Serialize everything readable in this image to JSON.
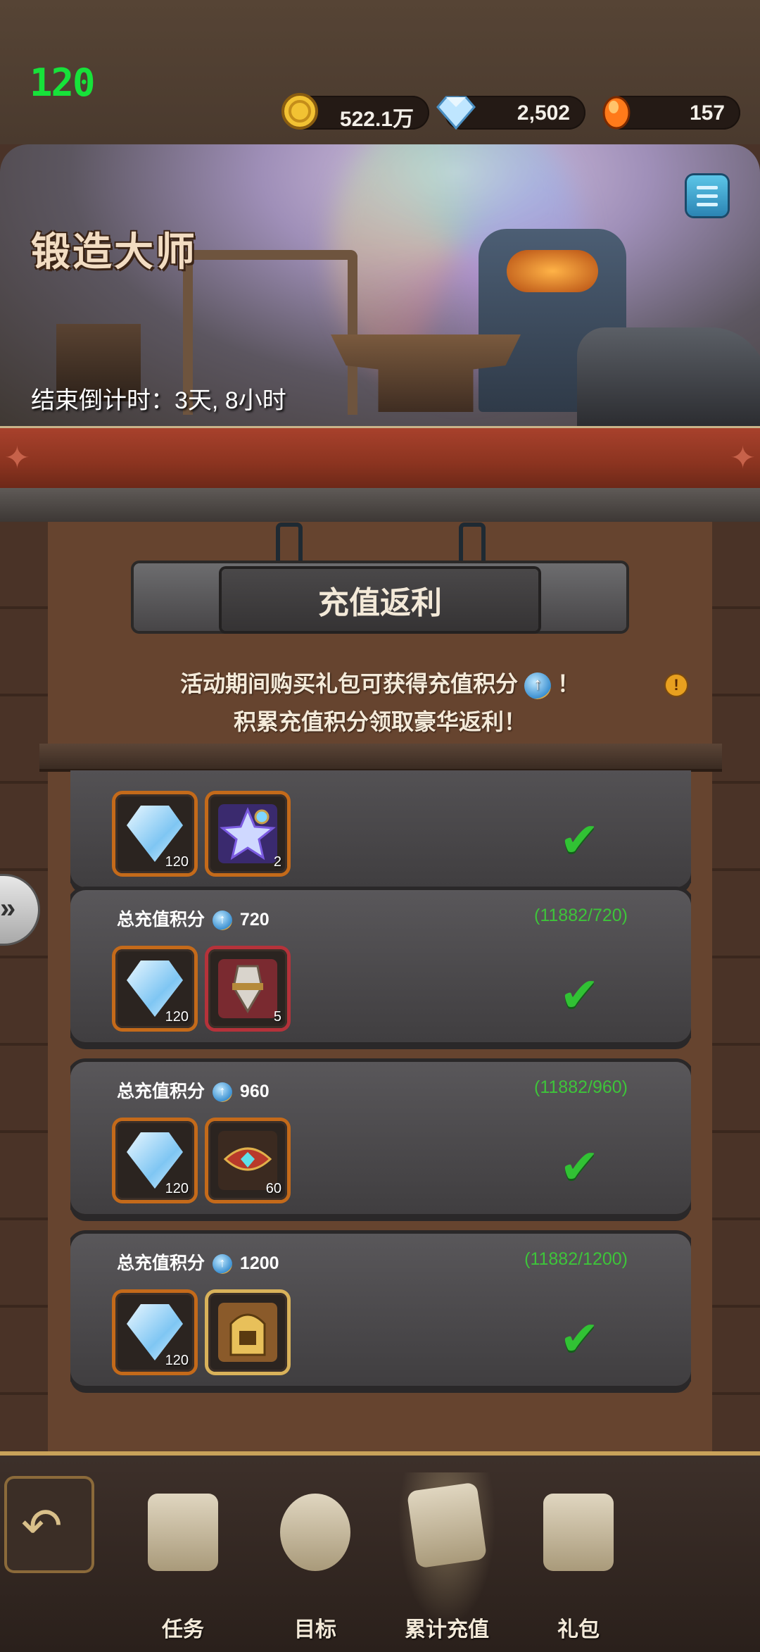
{
  "status": {
    "fps": "120",
    "resources": [
      {
        "name": "gold",
        "value": "522.1万",
        "icon": "gold-coin-icon",
        "color": "#f2c233"
      },
      {
        "name": "diamond",
        "value": "2,502",
        "icon": "diamond-icon",
        "color": "#9fd8ff"
      },
      {
        "name": "ember",
        "value": "157",
        "icon": "fire-gem-icon",
        "color": "#ff7a1a"
      }
    ]
  },
  "banner": {
    "title": "锻造大师",
    "countdown": "结束倒计时：3天, 8小时"
  },
  "section": {
    "title": "充值返利",
    "desc_line1": "活动期间购买礼包可获得充值积分",
    "desc_line1_end": "！",
    "desc_line2": "积累充值积分领取豪华返利！",
    "info_icon": "!"
  },
  "rewards": [
    {
      "label": "",
      "points": "",
      "progress": "",
      "items": [
        {
          "icon": "diamond-icon",
          "count": "120"
        },
        {
          "icon": "star-potion-icon",
          "count": "2"
        }
      ],
      "claimed": true
    },
    {
      "label": "总充值积分",
      "points": "720",
      "progress": "(11882/720)",
      "items": [
        {
          "icon": "diamond-icon",
          "count": "120"
        },
        {
          "icon": "crystal-shard-icon",
          "count": "5"
        }
      ],
      "claimed": true
    },
    {
      "label": "总充值积分",
      "points": "960",
      "progress": "(11882/960)",
      "items": [
        {
          "icon": "diamond-icon",
          "count": "120"
        },
        {
          "icon": "scroll-gem-icon",
          "count": "60"
        }
      ],
      "claimed": true
    },
    {
      "label": "总充值积分",
      "points": "1200",
      "progress": "(11882/1200)",
      "items": [
        {
          "icon": "diamond-icon",
          "count": "120"
        },
        {
          "icon": "golden-helmet-icon",
          "count": ""
        }
      ],
      "claimed": true
    }
  ],
  "nav": {
    "items": [
      {
        "label": "任务",
        "icon": "scroll-icon"
      },
      {
        "label": "目标",
        "icon": "target-icon"
      },
      {
        "label": "累计充值",
        "icon": "cards-icon",
        "active": true
      },
      {
        "label": "礼包",
        "icon": "gift-icon"
      }
    ]
  }
}
